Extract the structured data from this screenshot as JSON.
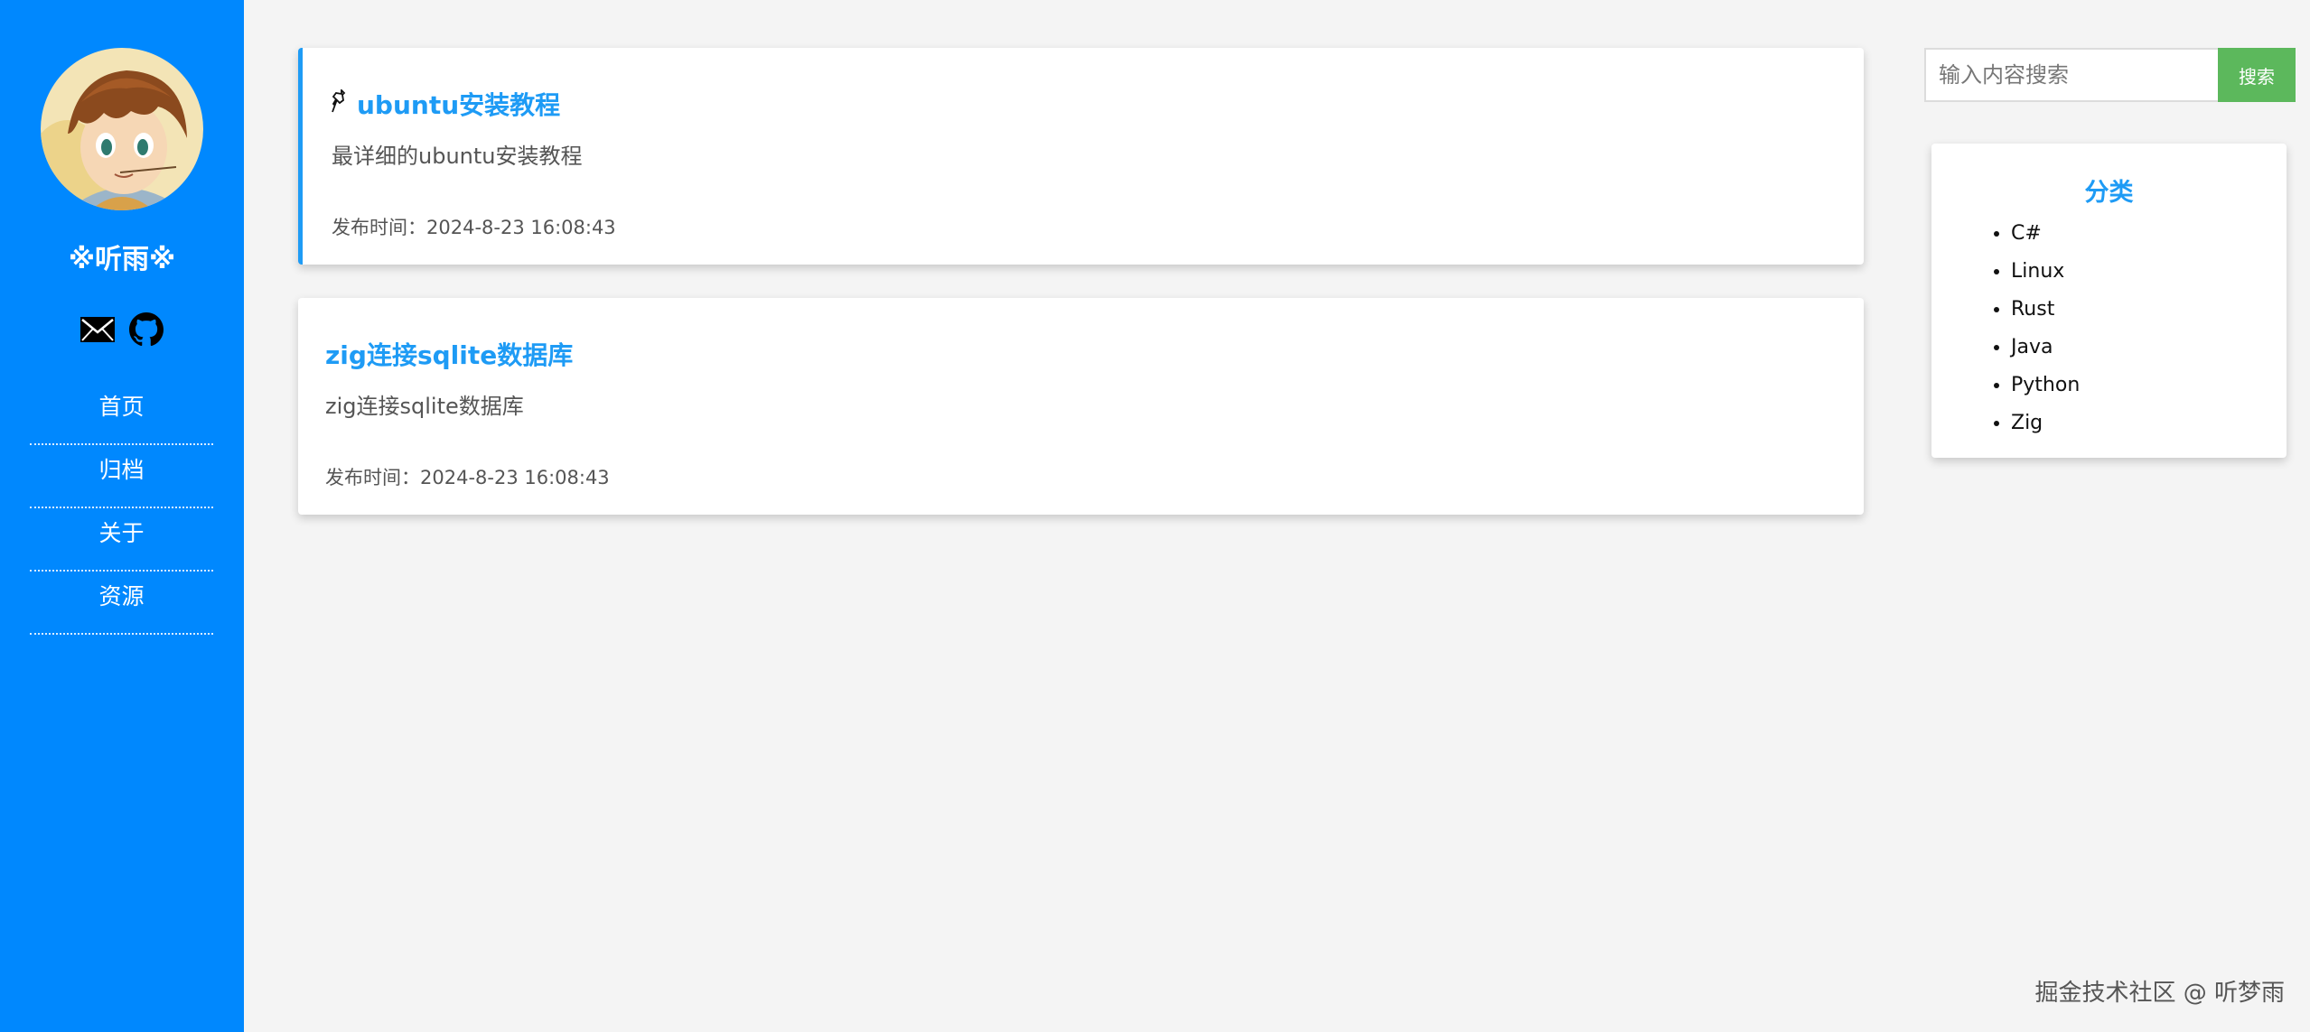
{
  "sidebar": {
    "site_name": "※听雨※",
    "nav": [
      {
        "label": "首页"
      },
      {
        "label": "归档"
      },
      {
        "label": "关于"
      },
      {
        "label": "资源"
      }
    ],
    "social_icons": [
      "mail-icon",
      "github-icon"
    ]
  },
  "posts": [
    {
      "title": "ubuntu安装教程",
      "pinned": true,
      "pin_icon": "pin-icon",
      "description": "最详细的ubuntu安装教程",
      "meta": "发布时间：2024-8-23 16:08:43"
    },
    {
      "title": "zig连接sqlite数据库",
      "pinned": false,
      "description": "zig连接sqlite数据库",
      "meta": "发布时间：2024-8-23 16:08:43"
    }
  ],
  "search": {
    "placeholder": "输入内容搜索",
    "button_label": "搜索"
  },
  "categories": {
    "title": "分类",
    "items": [
      "C#",
      "Linux",
      "Rust",
      "Java",
      "Python",
      "Zig"
    ]
  },
  "watermark": "掘金技术社区 @ 听梦雨",
  "colors": {
    "sidebar_bg": "#0088fe",
    "accent": "#1e9bf5",
    "search_button": "#5cb85c",
    "page_bg": "#f4f4f4"
  }
}
